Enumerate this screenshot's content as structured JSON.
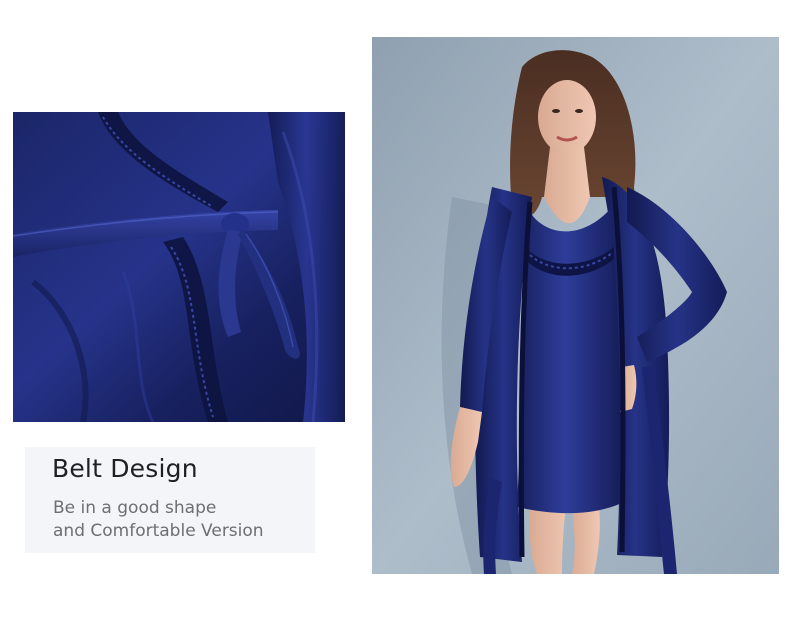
{
  "caption": {
    "title": "Belt Design",
    "line1": "Be in a good shape",
    "line2": "and Comfortable Version"
  },
  "colors": {
    "background": "#ffffff",
    "caption_card": "#f3f5f8",
    "title_text": "#1f1f24",
    "body_text": "#6e6e74",
    "silk_navy": "#17205a",
    "backdrop_blue_gray": "#a6b6c4"
  }
}
